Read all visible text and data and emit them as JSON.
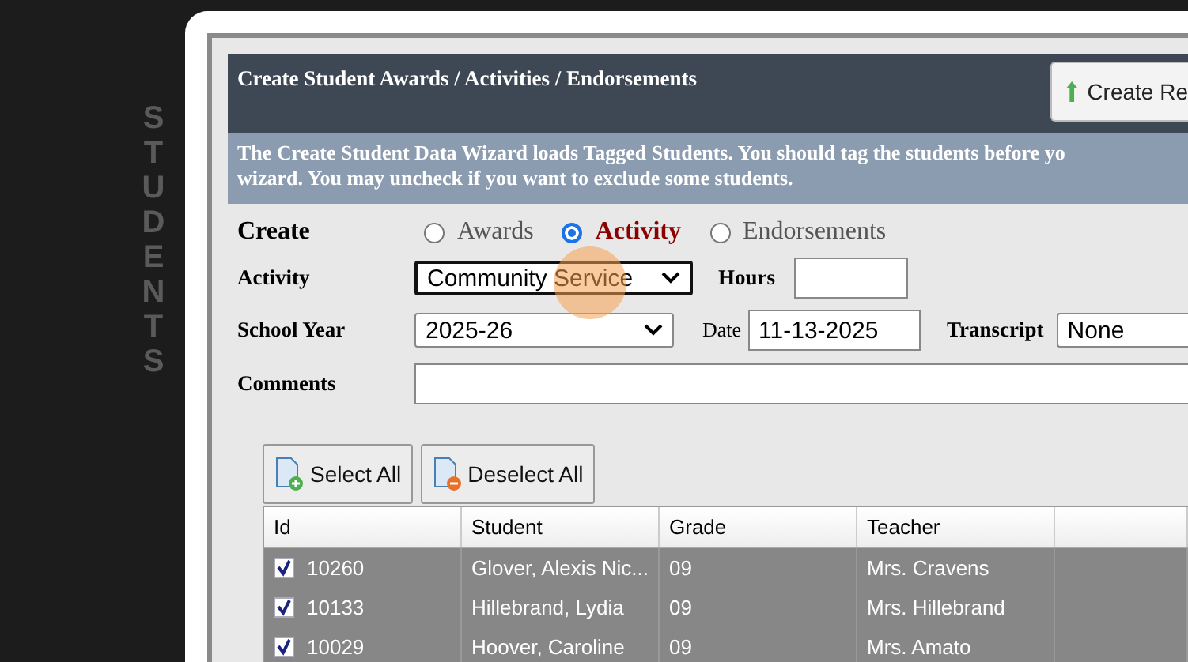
{
  "sidebar": {
    "label": "STUDENTS"
  },
  "dialog": {
    "title": "Create Student Awards / Activities / Endorsements",
    "action_button": "Create Re",
    "info_lines": [
      "The Create Student Data Wizard loads Tagged Students. You should tag the students before yo",
      "wizard. You may uncheck if you want to exclude some students."
    ]
  },
  "create": {
    "label": "Create",
    "options": [
      {
        "label": "Awards",
        "selected": false
      },
      {
        "label": "Activity",
        "selected": true
      },
      {
        "label": "Endorsements",
        "selected": false
      }
    ]
  },
  "activity": {
    "label": "Activity",
    "value": "Community Service"
  },
  "hours": {
    "label": "Hours"
  },
  "school_year": {
    "label": "School Year",
    "value": "2025-26"
  },
  "date": {
    "label": "Date",
    "value": "11-13-2025"
  },
  "transcript": {
    "label": "Transcript",
    "value": "None"
  },
  "comments": {
    "label": "Comments"
  },
  "buttons": [
    "Select All",
    "Deselect All"
  ],
  "table": {
    "columns": [
      "Id",
      "Student",
      "Grade",
      "Teacher"
    ],
    "rows": [
      {
        "checked": true,
        "cells": [
          "10260",
          "Glover, Alexis Nic...",
          "09",
          "Mrs. Cravens"
        ]
      },
      {
        "checked": true,
        "cells": [
          "10133",
          "Hillebrand, Lydia",
          "09",
          "Mrs. Hillebrand"
        ]
      },
      {
        "checked": true,
        "cells": [
          "10029",
          "Hoover, Caroline",
          "09",
          "Mrs. Amato"
        ]
      }
    ]
  }
}
